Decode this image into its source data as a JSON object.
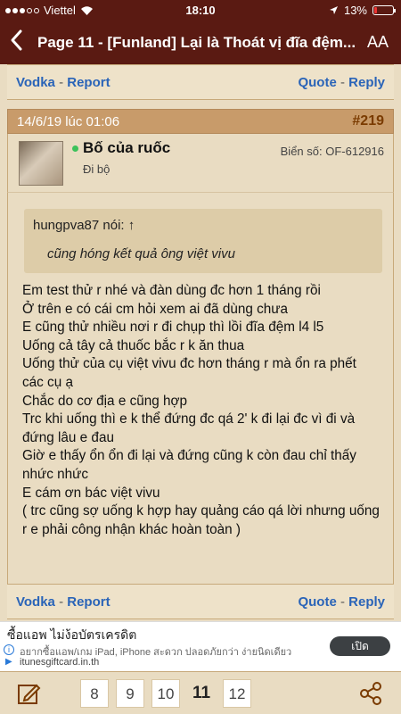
{
  "status_bar": {
    "carrier": "Viettel",
    "time": "18:10",
    "battery": "13%",
    "battery_level": 0.13
  },
  "nav": {
    "back_icon": "chevron-left-icon",
    "title": "Page 11 - [Funland]   Lại là Thoát vị đĩa đệm...",
    "font_size_label": "AA"
  },
  "prev_actions": {
    "left_user": "Vodka",
    "left_sep": " - ",
    "left_action": "Report",
    "right_quote": "Quote",
    "right_sep": " - ",
    "right_reply": "Reply"
  },
  "post": {
    "date": "14/6/19 lúc 01:06",
    "number": "#219",
    "author": {
      "name": "Bố của ruốc",
      "title": "Đi bộ",
      "plate": "Biển số: OF-612916",
      "online_color": "#3cc25a"
    },
    "quote": {
      "header": "hungpva87 nói: ↑",
      "text": "cũng hóng kết quả ông việt vivu"
    },
    "message_lines": [
      "Em test thử r nhé và đàn dùng đc hơn 1 tháng rồi",
      "Ở trên e có cái cm hỏi xem ai đã dùng chưa",
      "E cũng thử nhiều nơi r đi chụp thì lồi đĩa đệm l4 l5",
      "Uống cả tây cả thuốc bắc r k ăn thua",
      "Uống thử của cụ việt vivu đc hơn tháng r mà ổn ra phết",
      "các cụ ạ",
      "Chắc do cơ địa e cũng hợp",
      "Trc khi uống thì e k thể đứng đc qá 2' k đi lại đc vì đi và",
      "đứng lâu e đau",
      "Giờ e thấy ổn ổn đi lại và đứng cũng k còn đau chỉ thấy",
      "nhức nhức",
      "E cám ơn bác việt vivu",
      "( trc cũng sợ uống k hợp hay quảng cáo qá lời nhưng uống",
      "r e phải công nhận khác hoàn toàn )"
    ]
  },
  "post_actions": {
    "left_user": "Vodka",
    "left_sep": " - ",
    "left_action": "Report",
    "right_quote": "Quote",
    "right_sep": " - ",
    "right_reply": "Reply"
  },
  "ad": {
    "title": "ซื้อแอพ ไม่ง้อบัตรเครดิต",
    "subtitle": "อยากซื้อแอพ/เกม iPad, iPhone สะดวก ปลอดภัยกว่า ง่ายนิดเดียว",
    "domain": "itunesgiftcard.in.th",
    "open_button": "เปิด"
  },
  "pagination": {
    "pages": [
      "8",
      "9",
      "10",
      "11",
      "12"
    ],
    "current": "11"
  },
  "colors": {
    "header_bg": "#5a1a12",
    "link": "#2a64b8",
    "post_number": "#7a3b00",
    "page_bg": "#e9dcc2"
  }
}
